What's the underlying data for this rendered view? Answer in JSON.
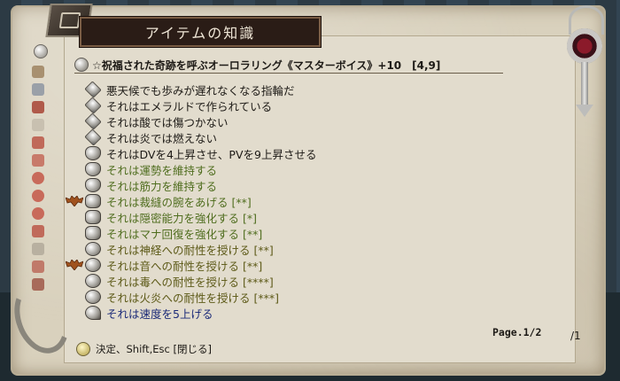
{
  "window": {
    "title": "アイテムの知識"
  },
  "item": {
    "name": "☆祝福された奇跡を呼ぶオーロラリング《マスターボイス》+10　[4,9]"
  },
  "properties": [
    {
      "text": "悪天候でも歩みが遅れなくなる指輪だ",
      "color": "black",
      "icon": "diamond-icon",
      "marker": ""
    },
    {
      "text": "それはエメラルドで作られている",
      "color": "black",
      "icon": "diamond-icon",
      "marker": ""
    },
    {
      "text": "それは酸では傷つかない",
      "color": "black",
      "icon": "diamond-icon",
      "marker": ""
    },
    {
      "text": "それは炎では燃えない",
      "color": "black",
      "icon": "diamond-icon",
      "marker": ""
    },
    {
      "text": "それはDVを4上昇させ、PVを9上昇させる",
      "color": "black",
      "icon": "shield-icon",
      "marker": ""
    },
    {
      "text": "それは運勢を維持する",
      "color": "green",
      "icon": "shield-icon",
      "marker": ""
    },
    {
      "text": "それは筋力を維持する",
      "color": "green",
      "icon": "shield-icon",
      "marker": ""
    },
    {
      "text": "それは裁縫の腕をあげる [**]",
      "color": "green",
      "icon": "gear-icon",
      "marker": "bat-icon"
    },
    {
      "text": "それは隠密能力を強化する [*]",
      "color": "green",
      "icon": "gear-icon",
      "marker": ""
    },
    {
      "text": "それはマナ回復を強化する [**]",
      "color": "green",
      "icon": "gear-icon",
      "marker": ""
    },
    {
      "text": "それは神経への耐性を授ける [**]",
      "color": "olive",
      "icon": "orb-icon",
      "marker": ""
    },
    {
      "text": "それは音への耐性を授ける [**]",
      "color": "olive",
      "icon": "orb-icon",
      "marker": "bat-icon"
    },
    {
      "text": "それは毒への耐性を授ける [****]",
      "color": "olive",
      "icon": "orb-icon",
      "marker": ""
    },
    {
      "text": "それは火炎への耐性を授ける [***]",
      "color": "olive",
      "icon": "orb-icon",
      "marker": ""
    },
    {
      "text": "それは速度を5上げる",
      "color": "blue",
      "icon": "key-icon",
      "marker": ""
    }
  ],
  "pagination": {
    "page": "Page.1/2",
    "extra": "/1"
  },
  "footer": {
    "hint": "決定、Shift,Esc [閉じる]"
  },
  "colors": {
    "black": "#1d1a16",
    "green": "#4f6d1e",
    "olive": "#5d5a18",
    "blue": "#1b2a78"
  }
}
